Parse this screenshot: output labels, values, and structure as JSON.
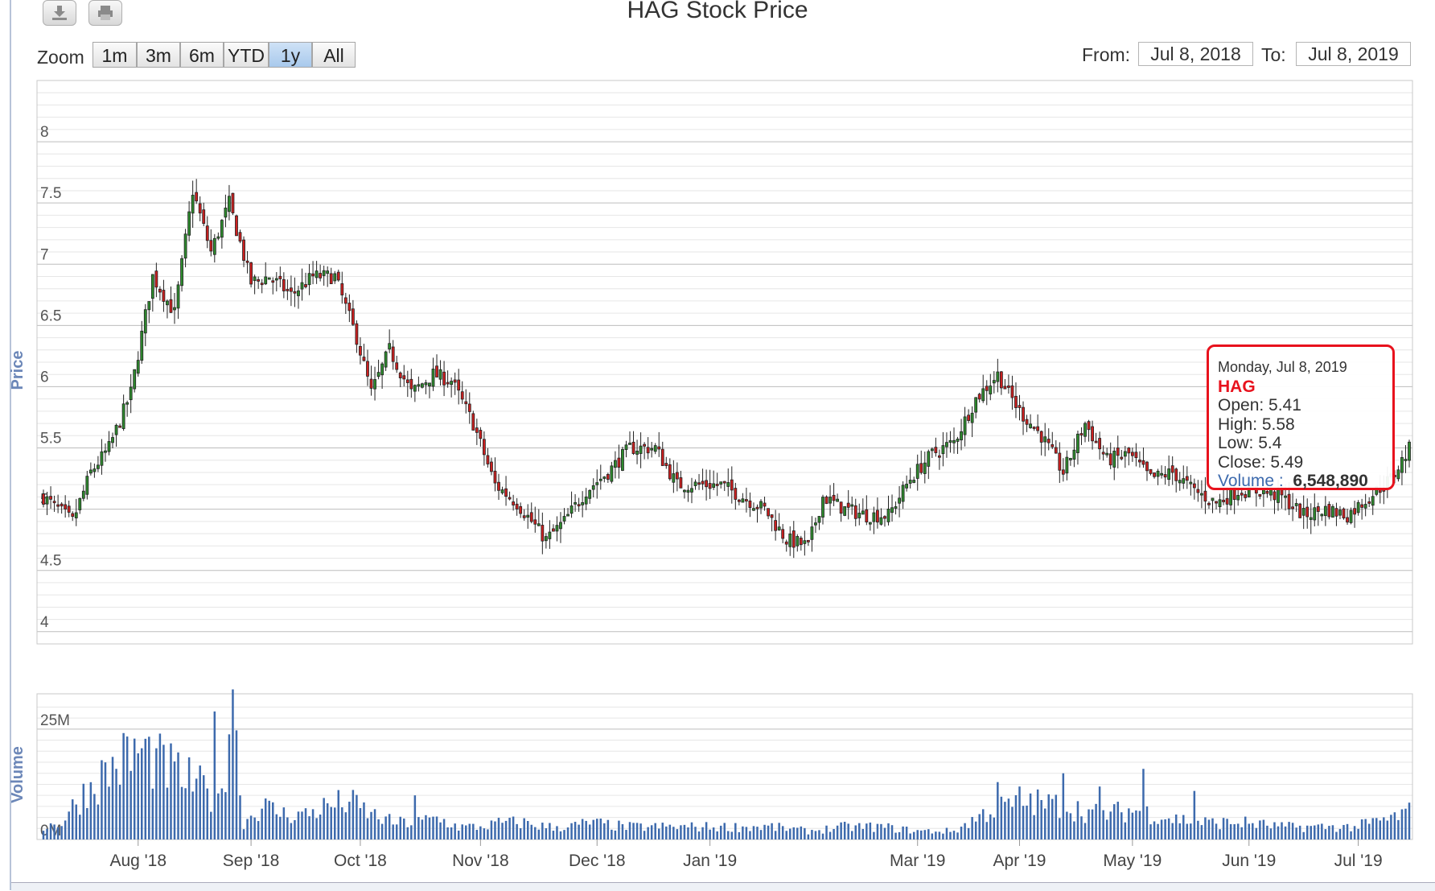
{
  "title": "HAG Stock Price",
  "toolbar": {
    "download_icon": "download-icon",
    "print_icon": "print-icon"
  },
  "zoom": {
    "label": "Zoom",
    "buttons": [
      "1m",
      "3m",
      "6m",
      "YTD",
      "1y",
      "All"
    ],
    "active": "1y"
  },
  "range": {
    "from_label": "From:",
    "from_value": "Jul 8, 2018",
    "to_label": "To:",
    "to_value": "Jul 8, 2019"
  },
  "tooltip": {
    "date": "Monday, Jul 8, 2019",
    "symbol": "HAG",
    "open": "Open: 5.41",
    "high": "High: 5.58",
    "low": "Low: 5.4",
    "close": "Close: 5.49",
    "volume_label": "Volume :",
    "volume_value": "6,548,890"
  },
  "colors": {
    "up": "#2e8b2e",
    "down": "#cc2020",
    "volume": "#3d6aad",
    "grid": "#cfcfcf",
    "tooltip_border": "#e8121d"
  },
  "chart_data": {
    "type": "candlestick",
    "price_axis": {
      "title": "Price",
      "ticks": [
        4,
        4.5,
        5,
        5.5,
        6,
        6.5,
        7,
        7.5,
        8
      ],
      "tick_labels": [
        "4",
        "4.5",
        "5",
        "5.5",
        "6",
        "6.5",
        "7",
        "7.5",
        "8"
      ],
      "ylim": [
        3.9,
        8.5
      ]
    },
    "volume_axis": {
      "title": "Volume",
      "ticks": [
        0,
        25
      ],
      "tick_labels": [
        "0M",
        "25M"
      ],
      "ylim": [
        0,
        33
      ]
    },
    "x_axis": {
      "labels": [
        "Aug '18",
        "Sep '18",
        "Oct '18",
        "Nov '18",
        "Dec '18",
        "Jan '19",
        "Mar '19",
        "Apr '19",
        "May '19",
        "Jun '19",
        "Jul '19"
      ]
    },
    "series": [
      {
        "name": "HAG",
        "anchors_close": [
          [
            0,
            5.1
          ],
          [
            8,
            4.9
          ],
          [
            13,
            5.3
          ],
          [
            18,
            5.5
          ],
          [
            24,
            5.95
          ],
          [
            30,
            6.9
          ],
          [
            36,
            6.6
          ],
          [
            41,
            7.6
          ],
          [
            46,
            7.1
          ],
          [
            51,
            7.5
          ],
          [
            57,
            6.85
          ],
          [
            62,
            6.9
          ],
          [
            68,
            6.75
          ],
          [
            74,
            6.9
          ],
          [
            80,
            6.9
          ],
          [
            86,
            6.4
          ],
          [
            90,
            5.95
          ],
          [
            95,
            6.3
          ],
          [
            101,
            5.95
          ],
          [
            107,
            6.1
          ],
          [
            112,
            6.05
          ],
          [
            118,
            5.7
          ],
          [
            124,
            5.2
          ],
          [
            130,
            5.05
          ],
          [
            138,
            4.75
          ],
          [
            143,
            4.9
          ],
          [
            149,
            5.15
          ],
          [
            155,
            5.3
          ],
          [
            161,
            5.5
          ],
          [
            168,
            5.5
          ],
          [
            174,
            5.2
          ],
          [
            180,
            5.2
          ],
          [
            186,
            5.2
          ],
          [
            192,
            5.1
          ],
          [
            198,
            5.0
          ],
          [
            204,
            4.75
          ],
          [
            210,
            4.7
          ],
          [
            214,
            5.1
          ],
          [
            220,
            5.0
          ],
          [
            226,
            4.95
          ],
          [
            232,
            4.95
          ],
          [
            238,
            5.25
          ],
          [
            244,
            5.45
          ],
          [
            250,
            5.55
          ],
          [
            256,
            5.9
          ],
          [
            262,
            6.1
          ],
          [
            268,
            5.8
          ],
          [
            274,
            5.6
          ],
          [
            280,
            5.3
          ],
          [
            286,
            5.7
          ],
          [
            292,
            5.4
          ],
          [
            298,
            5.45
          ],
          [
            304,
            5.25
          ],
          [
            310,
            5.3
          ],
          [
            316,
            5.15
          ],
          [
            322,
            5.05
          ],
          [
            328,
            5.15
          ],
          [
            334,
            5.15
          ],
          [
            340,
            5.1
          ],
          [
            346,
            4.95
          ],
          [
            352,
            5.0
          ],
          [
            358,
            4.95
          ],
          [
            364,
            5.1
          ],
          [
            370,
            5.25
          ],
          [
            375,
            5.49
          ]
        ]
      }
    ],
    "volume_anchors_millions": [
      [
        0,
        3
      ],
      [
        5,
        4
      ],
      [
        10,
        10
      ],
      [
        16,
        15
      ],
      [
        22,
        19
      ],
      [
        27,
        21
      ],
      [
        32,
        18
      ],
      [
        38,
        15
      ],
      [
        44,
        12
      ],
      [
        48,
        8
      ],
      [
        52,
        31
      ],
      [
        55,
        4
      ],
      [
        60,
        8
      ],
      [
        66,
        6
      ],
      [
        72,
        6
      ],
      [
        78,
        8
      ],
      [
        84,
        9
      ],
      [
        90,
        6
      ],
      [
        96,
        4
      ],
      [
        102,
        4
      ],
      [
        108,
        5
      ],
      [
        114,
        3
      ],
      [
        120,
        3
      ],
      [
        126,
        4
      ],
      [
        132,
        4
      ],
      [
        138,
        3
      ],
      [
        144,
        3
      ],
      [
        150,
        4
      ],
      [
        160,
        3
      ],
      [
        170,
        3
      ],
      [
        180,
        3
      ],
      [
        190,
        3
      ],
      [
        200,
        3
      ],
      [
        210,
        2
      ],
      [
        220,
        3
      ],
      [
        230,
        3
      ],
      [
        240,
        2
      ],
      [
        250,
        2
      ],
      [
        260,
        7
      ],
      [
        270,
        9
      ],
      [
        280,
        8
      ],
      [
        290,
        6
      ],
      [
        300,
        7
      ],
      [
        310,
        5
      ],
      [
        320,
        4
      ],
      [
        330,
        4
      ],
      [
        340,
        3
      ],
      [
        350,
        3
      ],
      [
        360,
        3
      ],
      [
        365,
        4
      ],
      [
        370,
        5
      ],
      [
        375,
        6.5
      ]
    ],
    "volume_spikes_millions": [
      [
        47,
        29
      ],
      [
        52,
        34
      ],
      [
        102,
        10
      ],
      [
        262,
        13
      ],
      [
        268,
        12
      ],
      [
        280,
        15
      ],
      [
        290,
        12
      ],
      [
        302,
        16
      ],
      [
        316,
        11
      ]
    ]
  }
}
